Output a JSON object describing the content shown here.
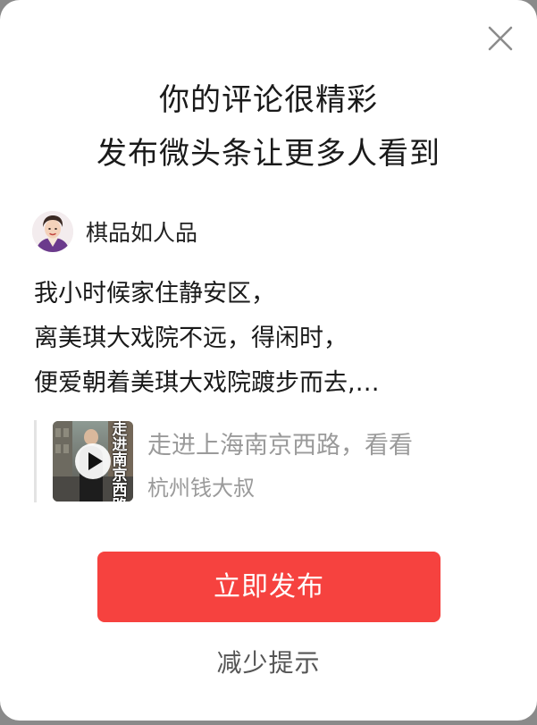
{
  "dialog": {
    "headline_line1": "你的评论很精彩",
    "headline_line2": "发布微头条让更多人看到",
    "author": {
      "name": "棋品如人品",
      "avatar_icon": "avatar-portrait-icon"
    },
    "comment_lines": [
      "我小时候家住静安区，",
      "离美琪大戏院不远，得闲时，",
      "便爱朝着美琪大戏院踱步而去,…"
    ],
    "quoted_video": {
      "thumbnail_caption": "走进南京西路",
      "title": "走进上海南京西路，看看",
      "author": "杭州钱大叔",
      "play_icon": "play-icon"
    },
    "publish_button": "立即发布",
    "reduce_link": "减少提示",
    "close_icon": "close-icon"
  },
  "colors": {
    "accent": "#f6423f",
    "muted_text": "#9a9a9a",
    "overlay": "#8a8a8a"
  }
}
